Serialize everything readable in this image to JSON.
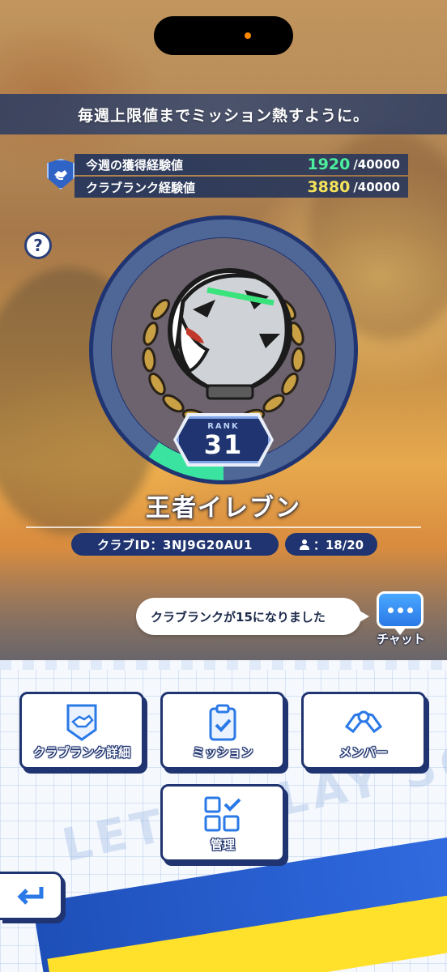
{
  "banner": {
    "text": "毎週上限値までミッション熱すように。"
  },
  "exp": {
    "weekly_label": "今週の獲得経験値",
    "weekly_value": "1920",
    "weekly_max": "/40000",
    "rank_label": "クラブランク経験値",
    "rank_value": "3880",
    "rank_max": "/40000",
    "weekly_progress": 0.048,
    "rank_progress": 0.097
  },
  "help": {
    "glyph": "?"
  },
  "rank": {
    "label": "RANK",
    "number": "31",
    "ring_progress": 0.097
  },
  "club": {
    "name": "王者イレブン",
    "id_text": "クラブID：3NJ9G20AU1",
    "members": "：18/20"
  },
  "chat": {
    "message": "クラブランクが15になりました",
    "button_label": "チャット"
  },
  "menu": {
    "detail_label": "クラブランク詳細",
    "mission_label": "ミッション",
    "member_label": "メンバー",
    "manage_label": "管理"
  },
  "watermark": "LET'S PLAY SOCCER!",
  "colors": {
    "navy": "#1f3470",
    "green": "#4bef9c",
    "yellow": "#f5e35a",
    "accent_blue": "#2a79e6"
  }
}
